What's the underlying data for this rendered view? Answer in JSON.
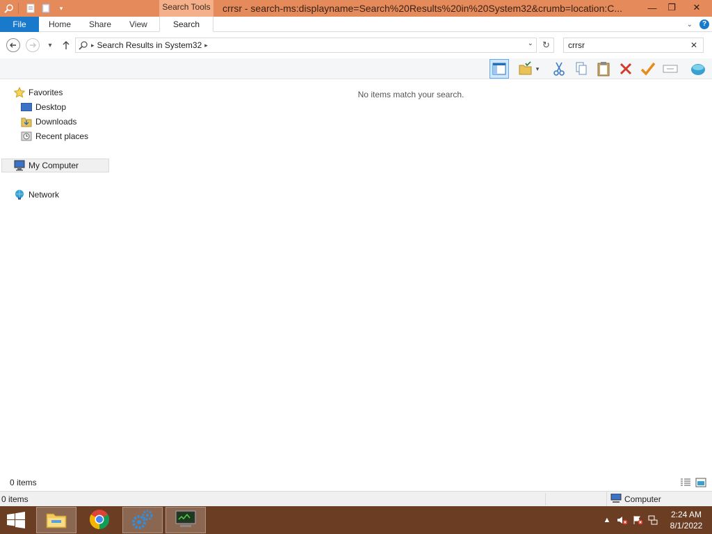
{
  "title_bar": {
    "contextual_group": "Search Tools",
    "window_title": "crrsr - search-ms:displayname=Search%20Results%20in%20System32&crumb=location:C..."
  },
  "ribbon": {
    "file": "File",
    "tabs": [
      "Home",
      "Share",
      "View"
    ],
    "search_tab": "Search"
  },
  "address": {
    "breadcrumb": "Search Results in System32"
  },
  "search": {
    "value": "crrsr"
  },
  "nav_pane": {
    "favorites": "Favorites",
    "desktop": "Desktop",
    "downloads": "Downloads",
    "recent": "Recent places",
    "computer": "My Computer",
    "network": "Network"
  },
  "content": {
    "empty_message": "No items match your search."
  },
  "status": {
    "count_top": "0 items",
    "count_bottom": "0 items",
    "location": "Computer"
  },
  "taskbar": {
    "time": "2:24 AM",
    "date": "8/1/2022"
  },
  "colors": {
    "title_bar": "#e58a5a",
    "file_tab": "#1979ca",
    "taskbar": "#6b3d22"
  }
}
